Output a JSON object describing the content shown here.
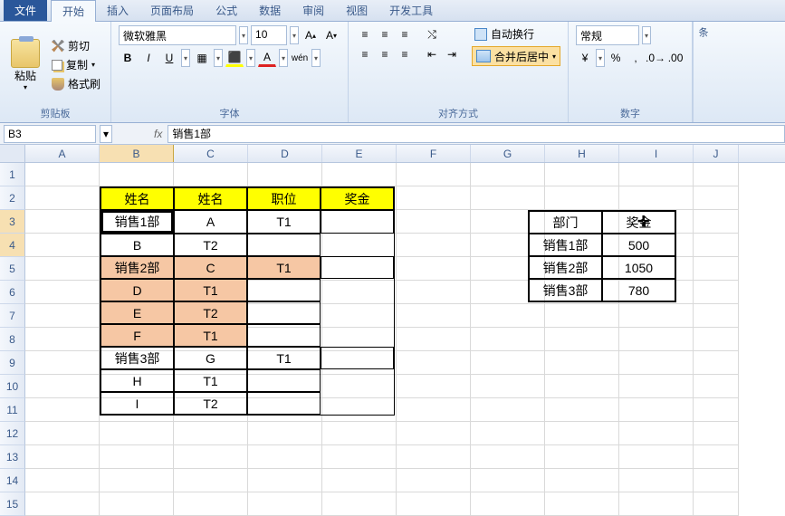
{
  "menu": {
    "file": "文件",
    "tabs": [
      "开始",
      "插入",
      "页面布局",
      "公式",
      "数据",
      "审阅",
      "视图",
      "开发工具"
    ],
    "active": 0
  },
  "ribbon": {
    "clipboard": {
      "title": "剪贴板",
      "paste": "粘贴",
      "cut": "剪切",
      "copy": "复制",
      "format_painter": "格式刷"
    },
    "font": {
      "title": "字体",
      "name": "微软雅黑",
      "size": "10"
    },
    "align": {
      "title": "对齐方式",
      "wrap": "自动换行",
      "merge": "合并后居中"
    },
    "number": {
      "title": "数字",
      "format": "常规"
    },
    "watch": "条"
  },
  "formula_bar": {
    "name_box": "B3",
    "fx": "fx",
    "value": "销售1部"
  },
  "columns": [
    "A",
    "B",
    "C",
    "D",
    "E",
    "F",
    "G",
    "H",
    "I",
    "J"
  ],
  "rows": [
    "1",
    "2",
    "3",
    "4",
    "5",
    "6",
    "7",
    "8",
    "9",
    "10",
    "11",
    "12",
    "13",
    "14",
    "15"
  ],
  "selected_col": "B",
  "selected_rows": [
    "3",
    "4"
  ],
  "table1": {
    "headers": [
      "姓名",
      "姓名",
      "职位",
      "奖金"
    ],
    "rows": [
      {
        "dept": "销售1部",
        "name": "A",
        "pos": "T1",
        "bonus": "",
        "span": 2,
        "class": ""
      },
      {
        "dept": "",
        "name": "B",
        "pos": "T2",
        "bonus": "",
        "span": 0,
        "class": ""
      },
      {
        "dept": "销售2部",
        "name": "C",
        "pos": "T1",
        "bonus": "",
        "span": 4,
        "class": "peach"
      },
      {
        "dept": "",
        "name": "D",
        "pos": "T1",
        "bonus": "",
        "span": 0,
        "class": "peach"
      },
      {
        "dept": "",
        "name": "E",
        "pos": "T2",
        "bonus": "",
        "span": 0,
        "class": "peach"
      },
      {
        "dept": "",
        "name": "F",
        "pos": "T1",
        "bonus": "",
        "span": 0,
        "class": "peach"
      },
      {
        "dept": "销售3部",
        "name": "G",
        "pos": "T1",
        "bonus": "",
        "span": 3,
        "class": ""
      },
      {
        "dept": "",
        "name": "H",
        "pos": "T1",
        "bonus": "",
        "span": 0,
        "class": ""
      },
      {
        "dept": "",
        "name": "I",
        "pos": "T2",
        "bonus": "",
        "span": 0,
        "class": ""
      }
    ]
  },
  "chart_data": {
    "type": "table",
    "title": "",
    "columns": [
      "部门",
      "奖金"
    ],
    "rows": [
      {
        "dept": "销售1部",
        "bonus": 500
      },
      {
        "dept": "销售2部",
        "bonus": 1050
      },
      {
        "dept": "销售3部",
        "bonus": 780
      }
    ]
  }
}
